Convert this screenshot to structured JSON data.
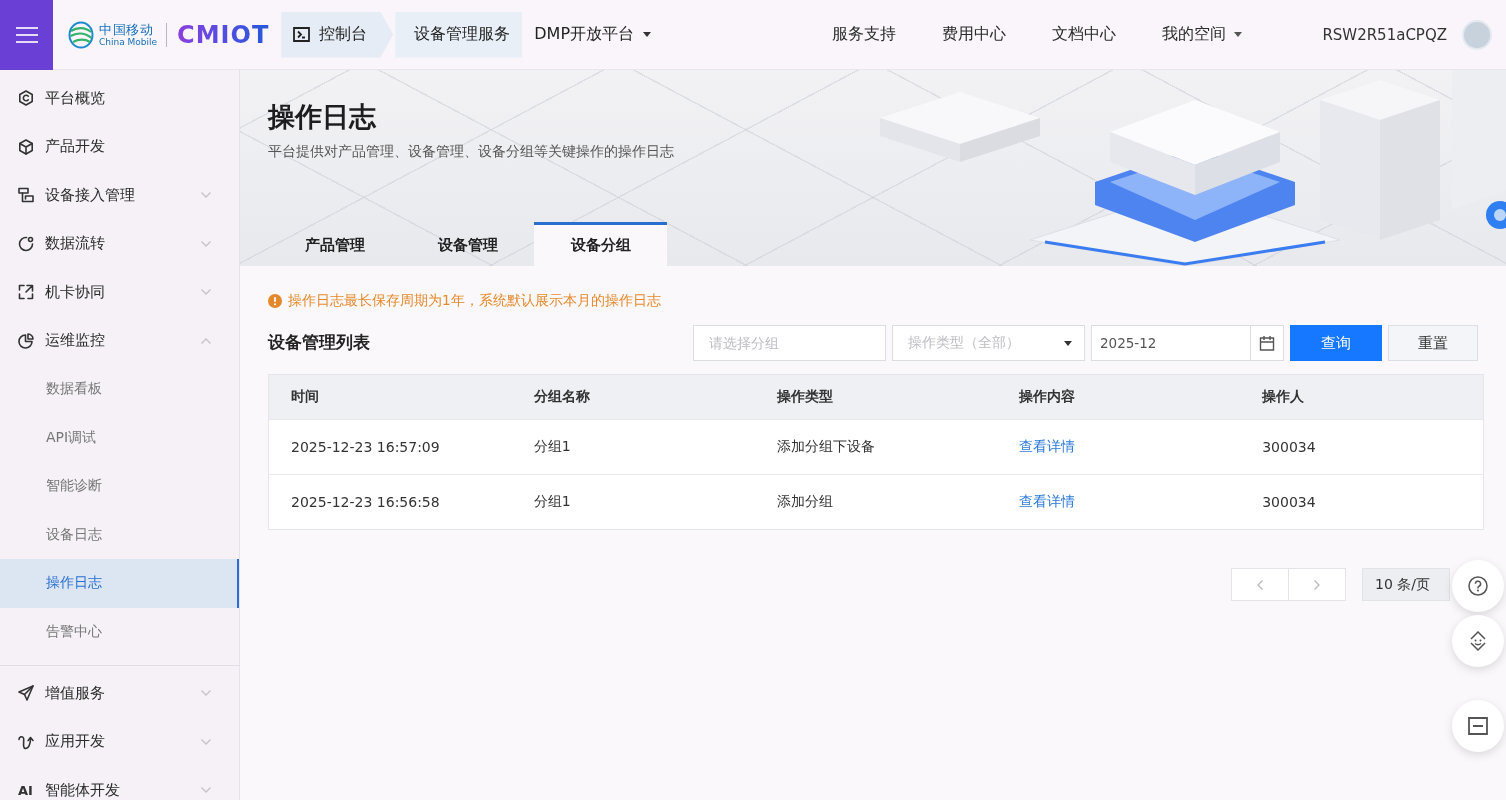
{
  "top_bar": {
    "brand": {
      "name_cn": "中国移动",
      "name_en": "China Mobile",
      "product": "CMIOT"
    },
    "breadcrumb": [
      {
        "label": "控制台",
        "kind": "home"
      },
      {
        "label": "设备管理服务",
        "kind": "crumb"
      },
      {
        "label": "DMP开放平台",
        "kind": "dropdown"
      }
    ],
    "nav": [
      {
        "label": "服务支持",
        "kind": "link"
      },
      {
        "label": "费用中心",
        "kind": "link"
      },
      {
        "label": "文档中心",
        "kind": "link"
      },
      {
        "label": "我的空间",
        "kind": "dropdown"
      }
    ],
    "user": {
      "name": "RSW2R51aCPQZ"
    }
  },
  "sidebar": {
    "items": [
      {
        "label": "平台概览",
        "kind": "link"
      },
      {
        "label": "产品开发",
        "kind": "link"
      },
      {
        "label": "设备接入管理",
        "kind": "group",
        "expanded": false
      },
      {
        "label": "数据流转",
        "kind": "group",
        "expanded": false
      },
      {
        "label": "机卡协同",
        "kind": "group",
        "expanded": false
      },
      {
        "label": "运维监控",
        "kind": "group",
        "expanded": true,
        "children": [
          {
            "label": "数据看板",
            "selected": false
          },
          {
            "label": "API调试",
            "selected": false
          },
          {
            "label": "智能诊断",
            "selected": false
          },
          {
            "label": "设备日志",
            "selected": false
          },
          {
            "label": "操作日志",
            "selected": true
          },
          {
            "label": "告警中心",
            "selected": false
          }
        ]
      },
      {
        "label": "增值服务",
        "kind": "group",
        "expanded": false
      },
      {
        "label": "应用开发",
        "kind": "group",
        "expanded": false
      },
      {
        "label": "智能体开发",
        "kind": "group",
        "expanded": false,
        "icon_text": "AI"
      }
    ]
  },
  "page_header": {
    "title": "操作日志",
    "subtitle": "平台提供对产品管理、设备管理、设备分组等关键操作的操作日志",
    "tabs": [
      {
        "label": "产品管理",
        "selected": false
      },
      {
        "label": "设备管理",
        "selected": false
      },
      {
        "label": "设备分组",
        "selected": true
      }
    ]
  },
  "notice": {
    "text": "操作日志最长保存周期为1年，系统默认展示本月的操作日志"
  },
  "list": {
    "title": "设备管理列表",
    "filters": [
      {
        "kind": "input",
        "placeholder": "请选择分组"
      },
      {
        "kind": "select",
        "placeholder": "操作类型（全部）"
      },
      {
        "kind": "month",
        "value": "2025-12"
      }
    ],
    "buttons": [
      {
        "label": "查询",
        "kind": "primary"
      },
      {
        "label": "重置",
        "kind": "default"
      }
    ]
  },
  "table": {
    "columns": [
      {
        "label": "时间",
        "kind": "text"
      },
      {
        "label": "分组名称",
        "kind": "text"
      },
      {
        "label": "操作类型",
        "kind": "text"
      },
      {
        "label": "操作内容",
        "kind": "link"
      },
      {
        "label": "操作人",
        "kind": "text"
      }
    ],
    "rows": [
      [
        "2025-12-23 16:57:09",
        "分组1",
        "添加分组下设备",
        "查看详情",
        "300034"
      ],
      [
        "2025-12-23 16:56:58",
        "分组1",
        "添加分组",
        "查看详情",
        "300034"
      ]
    ]
  },
  "pagination": {
    "page_size": "10 条/页"
  }
}
